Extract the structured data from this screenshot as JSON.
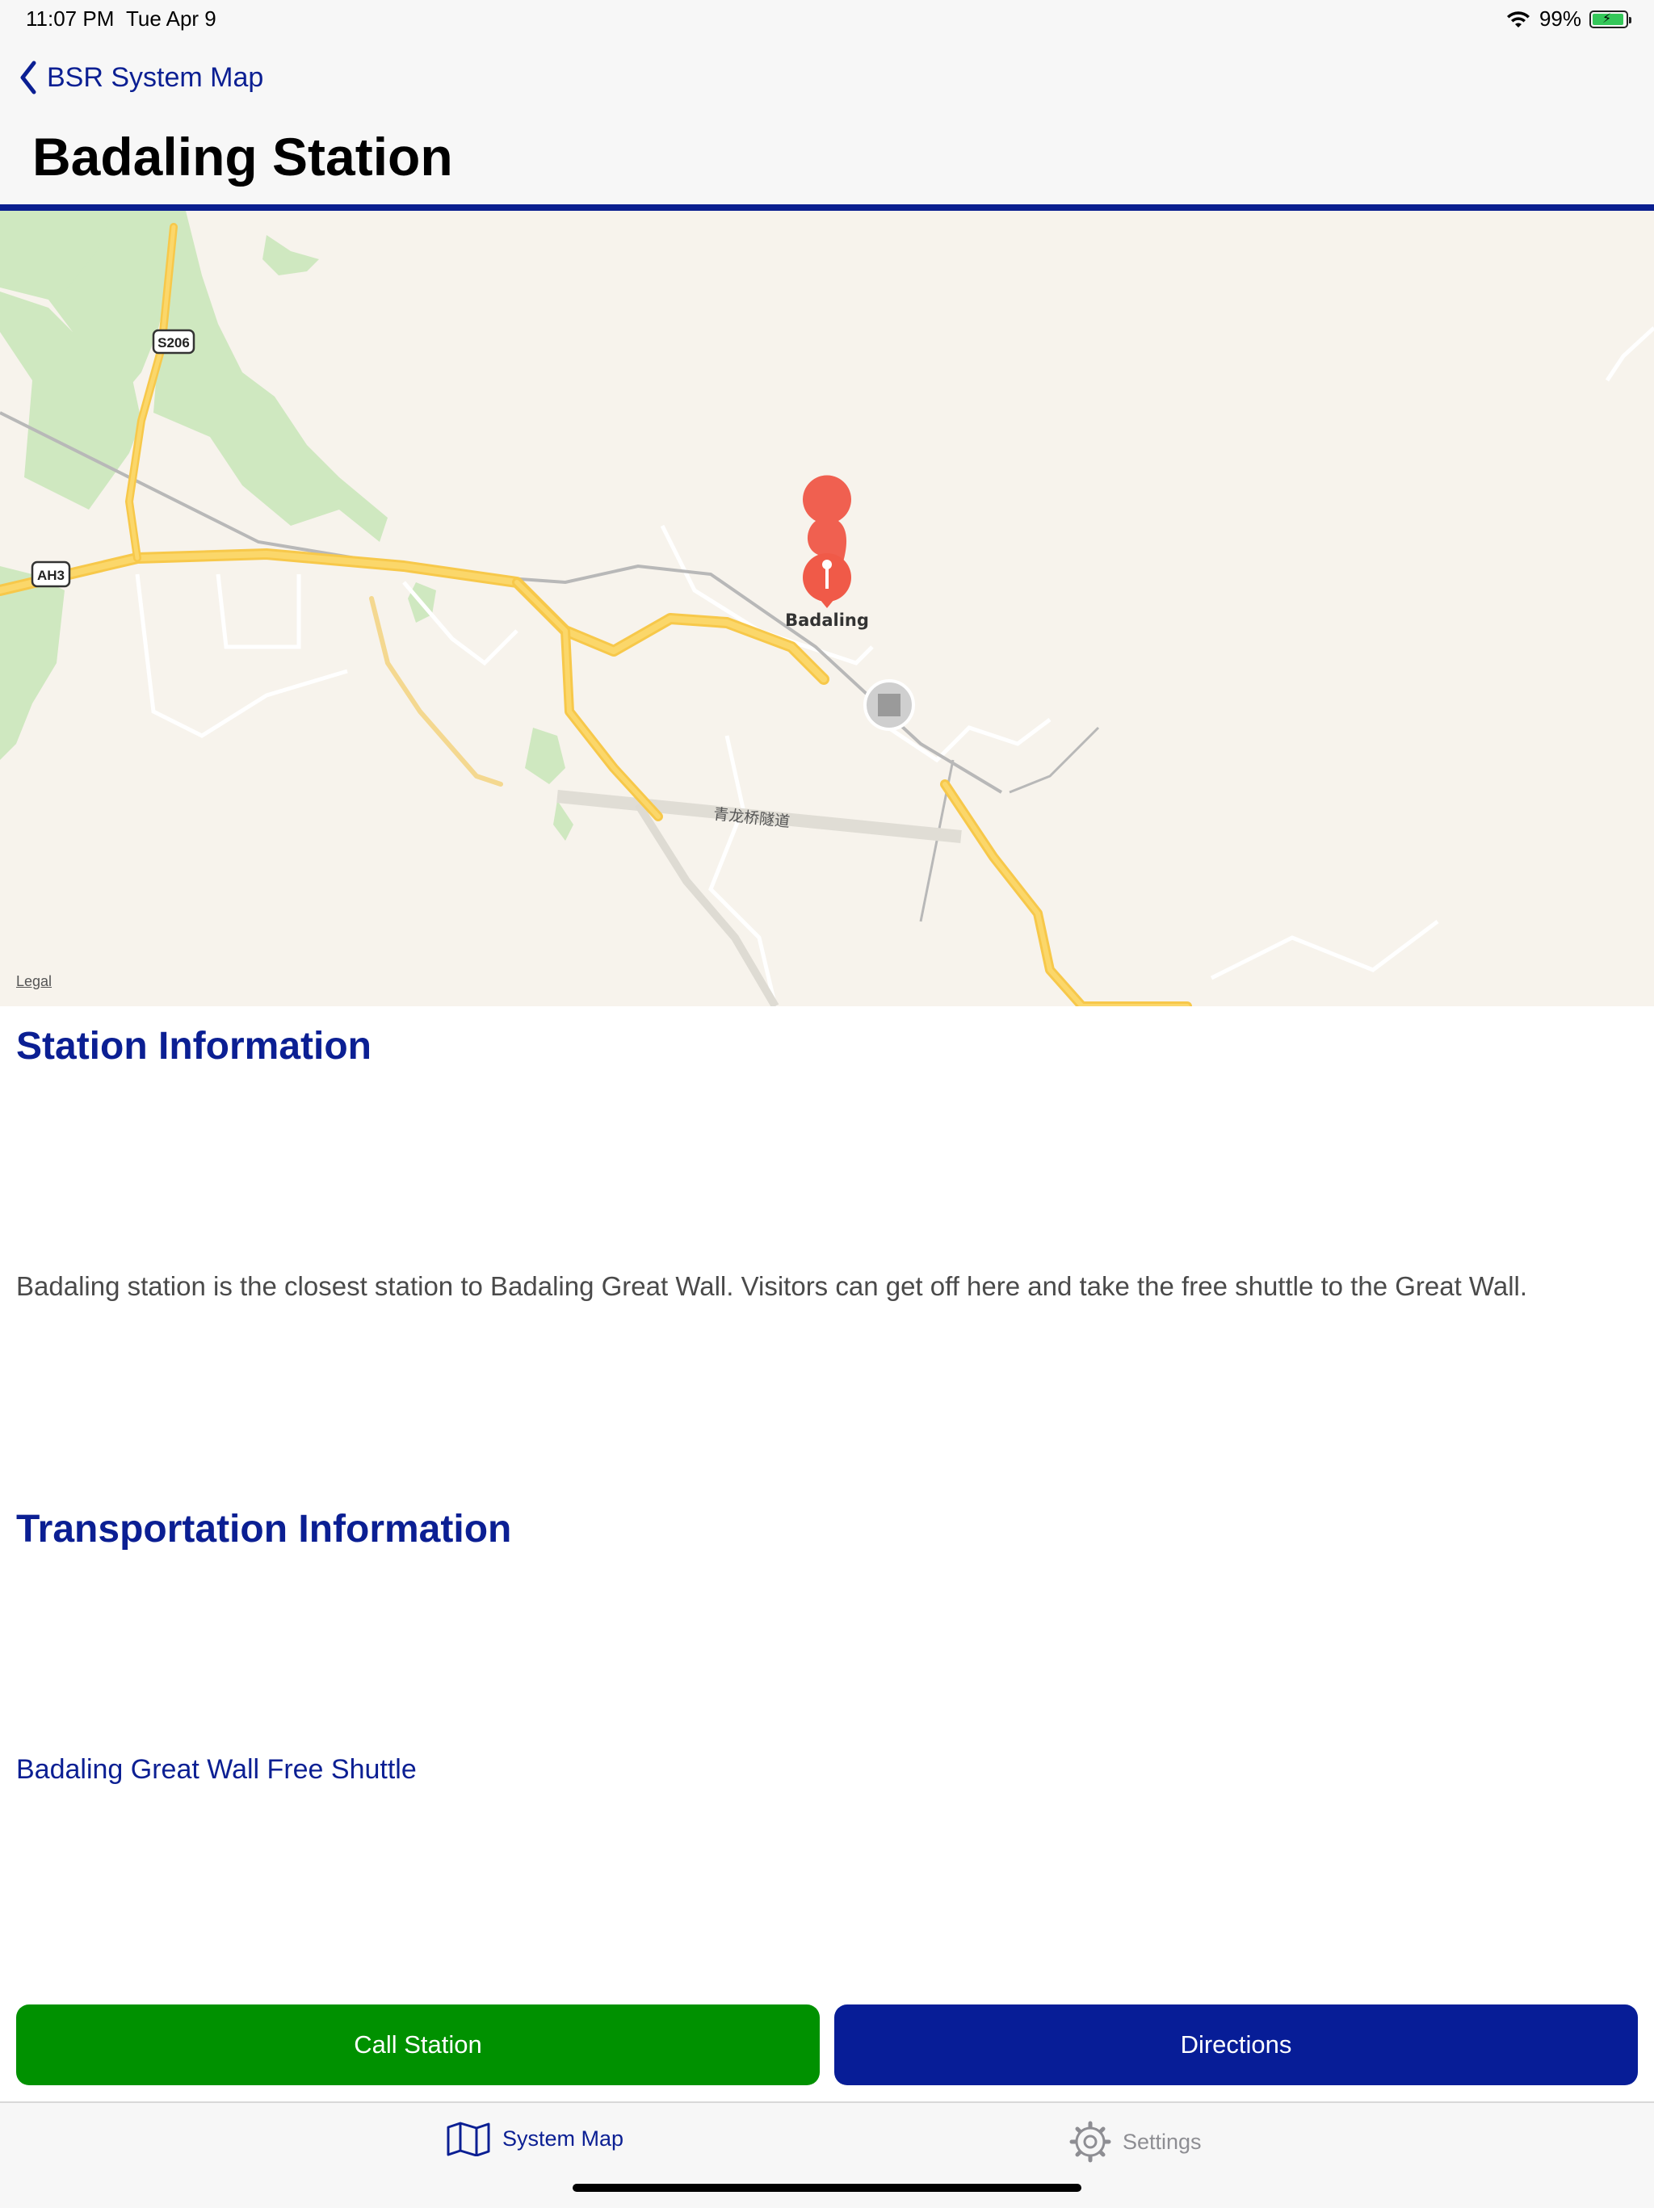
{
  "status_bar": {
    "time": "11:07 PM",
    "date": "Tue Apr 9",
    "battery": "99%",
    "battery_level": 0.99
  },
  "nav": {
    "back_label": "BSR System Map",
    "title": "Badaling Station"
  },
  "map": {
    "pin_label": "Badaling",
    "tunnel_label": "青龙桥隧道",
    "shields": [
      "S206",
      "AH3"
    ],
    "legal": "Legal"
  },
  "station_info": {
    "heading": "Station Information",
    "text": "Badaling station is the closest station to Badaling Great Wall. Visitors can get off here and take the free shuttle to the Great Wall."
  },
  "transport_info": {
    "heading": "Transportation Information",
    "link": "Badaling Great Wall Free Shuttle"
  },
  "buttons": {
    "call": "Call Station",
    "directions": "Directions"
  },
  "tabs": [
    {
      "label": "System Map",
      "icon": "map-icon",
      "selected": true
    },
    {
      "label": "Settings",
      "icon": "gear-icon",
      "selected": false
    }
  ],
  "colors": {
    "accent": "#0b1f93",
    "call_green": "#009100",
    "directions_blue": "#071d97"
  }
}
